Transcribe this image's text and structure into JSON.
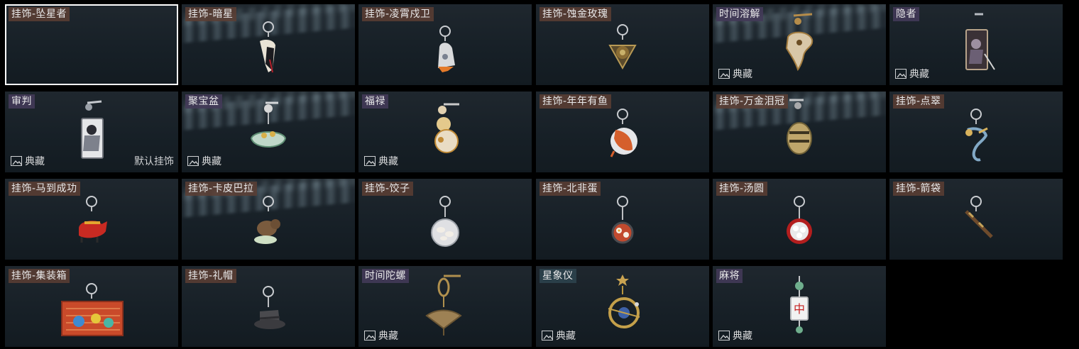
{
  "collection_badge_label": "典藏",
  "default_charm_label": "默认挂饰",
  "tiles": [
    {
      "name": "挂饰-坠星者",
      "selected": true,
      "badge": false,
      "icon": "empty-slot",
      "tag": "warm"
    },
    {
      "name": "挂饰-暗星",
      "badge": false,
      "icon": "dark-star-charm-icon",
      "light": true,
      "tag": "warm"
    },
    {
      "name": "挂饰-凌霄戍卫",
      "badge": false,
      "icon": "rocket-charm-icon",
      "tag": "warm"
    },
    {
      "name": "挂饰-蚀金玫瑰",
      "badge": false,
      "icon": "gold-rose-charm-icon",
      "tag": "warm"
    },
    {
      "name": "时间溶解",
      "badge": true,
      "icon": "melting-clock-charm-icon",
      "light": true,
      "tag": "purple"
    },
    {
      "name": "隐者",
      "badge": true,
      "icon": "hermit-tarot-charm-icon",
      "tag": "purple"
    },
    {
      "name": "审判",
      "badge": true,
      "icon": "judgement-tarot-charm-icon",
      "default": true,
      "tag": "purple"
    },
    {
      "name": "聚宝盆",
      "badge": true,
      "icon": "treasure-bowl-charm-icon",
      "light": true,
      "tag": "purple"
    },
    {
      "name": "福禄",
      "badge": true,
      "icon": "gourd-charm-icon",
      "tag": "purple"
    },
    {
      "name": "挂饰-年年有鱼",
      "badge": false,
      "icon": "fish-plate-charm-icon",
      "tag": "warm"
    },
    {
      "name": "挂饰-万金泪冠",
      "badge": false,
      "icon": "gold-crown-charm-icon",
      "light": true,
      "tag": "warm"
    },
    {
      "name": "挂饰-点翠",
      "badge": false,
      "icon": "kingfisher-charm-icon",
      "tag": "warm"
    },
    {
      "name": "挂饰-马到成功",
      "badge": false,
      "icon": "red-horse-charm-icon",
      "tag": "warm"
    },
    {
      "name": "挂饰-卡皮巴拉",
      "badge": false,
      "icon": "capybara-charm-icon",
      "light": true,
      "tag": "warm"
    },
    {
      "name": "挂饰-饺子",
      "badge": false,
      "icon": "dumpling-plate-charm-icon",
      "tag": "warm"
    },
    {
      "name": "挂饰-北非蛋",
      "badge": false,
      "icon": "shakshuka-pan-charm-icon",
      "tag": "warm"
    },
    {
      "name": "挂饰-汤圆",
      "badge": false,
      "icon": "tangyuan-bowl-charm-icon",
      "tag": "warm"
    },
    {
      "name": "挂饰-箭袋",
      "badge": false,
      "icon": "quiver-charm-icon",
      "tag": "warm"
    },
    {
      "name": "挂饰-集装箱",
      "badge": false,
      "icon": "container-charm-icon",
      "tag": "warm"
    },
    {
      "name": "挂饰-礼帽",
      "badge": false,
      "icon": "top-hat-charm-icon",
      "tag": "warm"
    },
    {
      "name": "时间陀螺",
      "badge": true,
      "icon": "spinning-top-charm-icon",
      "tag": "purple"
    },
    {
      "name": "星象仪",
      "badge": true,
      "icon": "astrolabe-charm-icon",
      "tag": "teal"
    },
    {
      "name": "麻将",
      "badge": true,
      "icon": "mahjong-tile-charm-icon",
      "tag": "purple"
    }
  ]
}
